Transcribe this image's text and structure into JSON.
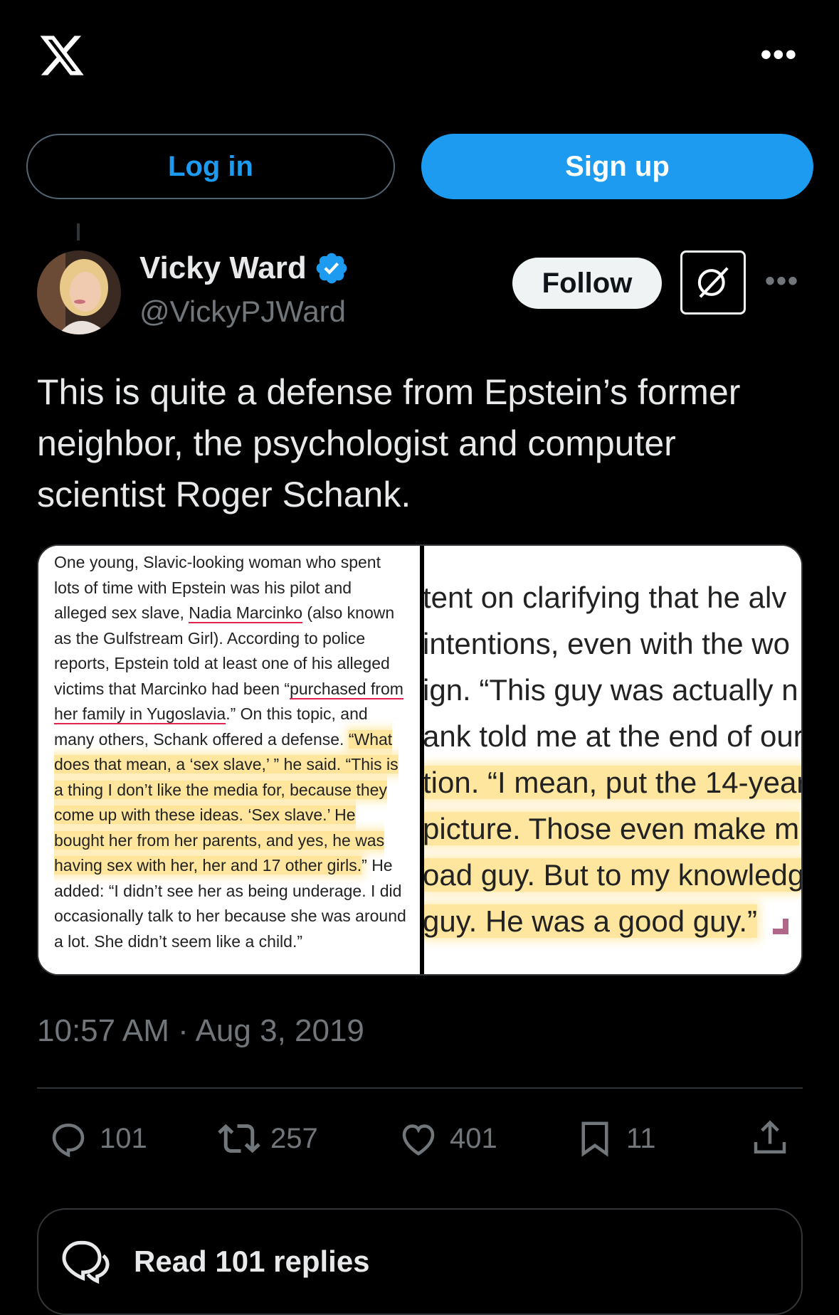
{
  "header": {
    "logo_icon": "x-logo-icon",
    "more_label": "•••"
  },
  "auth": {
    "login_label": "Log in",
    "signup_label": "Sign up"
  },
  "author": {
    "name": "Vicky Ward",
    "handle": "@VickyPJWard",
    "verified": true,
    "follow_label": "Follow",
    "more_label": "•••"
  },
  "post": {
    "text": "This is quite a defense from Epstein’s former neighbor, the psychologist and computer scientist Roger Schank.",
    "timestamp": "10:57 AM · Aug 3, 2019"
  },
  "media": {
    "left_excerpt": {
      "p1": "One young, Slavic-looking woman who spent lots of time with Epstein was his pilot and alleged sex slave, ",
      "link1": "Nadia Marcinko",
      "p2": " (also known as the Gulfstream Girl). According to police reports, Epstein told at least one of his alleged victims that Marcinko had been “",
      "link2": "purchased from her family in Yugoslavia",
      "p3": ".” On this topic, and many others, Schank offered a defense. ",
      "highlight": "“What does that mean, a ‘sex slave,’ ” he said. “This is a thing I don’t like the media for, because they come up with these ideas. ‘Sex slave.’ He bought her from her parents, and yes, he was having sex with her, her and 17 other girls.",
      "p4": "” He added: “I didn’t see her as being underage. I did occasionally talk to her because she was around a lot. She didn’t seem like a child.”"
    },
    "right_excerpt": {
      "lines": [
        "tent on clarifying that he alv",
        "intentions, even with the wo",
        "ign. “This guy was actually n",
        "ank told me at the end of our",
        "tion. “I mean, put the 14-year",
        " picture. Those even make m",
        "oad guy. But to my knowledg",
        "guy. He was a good guy.”"
      ]
    }
  },
  "actions": {
    "replies": "101",
    "reposts": "257",
    "likes": "401",
    "bookmarks": "11"
  },
  "read_replies_label": "Read 101 replies",
  "colors": {
    "background": "#000000",
    "accent": "#1d9bf0",
    "muted": "#71767b",
    "text": "#e7e9ea",
    "highlight": "#ffc828"
  }
}
